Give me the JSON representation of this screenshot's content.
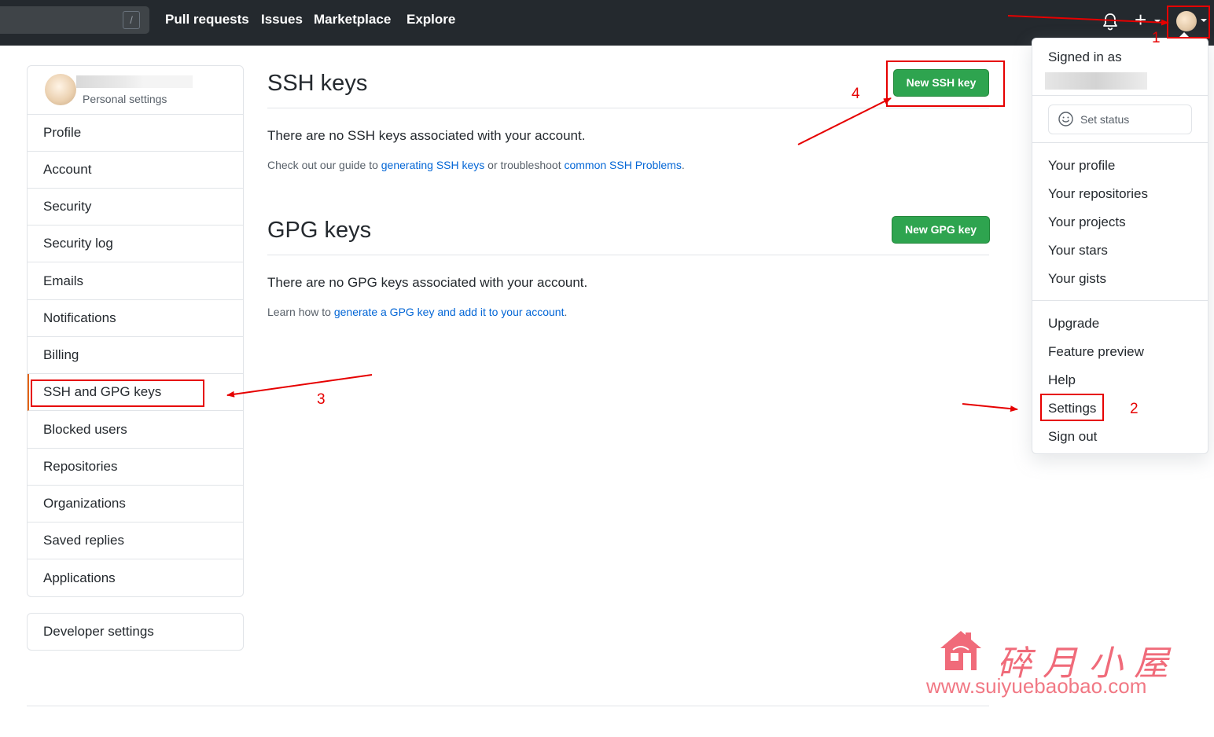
{
  "header": {
    "search_slash": "/",
    "nav": [
      "Pull requests",
      "Issues",
      "Marketplace",
      "Explore"
    ],
    "plus_icon": "+"
  },
  "sidebar": {
    "subtitle": "Personal settings",
    "items": [
      {
        "label": "Profile"
      },
      {
        "label": "Account"
      },
      {
        "label": "Security"
      },
      {
        "label": "Security log"
      },
      {
        "label": "Emails"
      },
      {
        "label": "Notifications"
      },
      {
        "label": "Billing"
      },
      {
        "label": "SSH and GPG keys"
      },
      {
        "label": "Blocked users"
      },
      {
        "label": "Repositories"
      },
      {
        "label": "Organizations"
      },
      {
        "label": "Saved replies"
      },
      {
        "label": "Applications"
      }
    ],
    "developer_settings": "Developer settings"
  },
  "ssh": {
    "title": "SSH keys",
    "button": "New SSH key",
    "empty": "There are no SSH keys associated with your account.",
    "guide_prefix": "Check out our guide to ",
    "guide_link": "generating SSH keys",
    "guide_mid": " or troubleshoot ",
    "guide_link2": "common SSH Problems",
    "guide_suffix": "."
  },
  "gpg": {
    "title": "GPG keys",
    "button": "New GPG key",
    "empty": "There are no GPG keys associated with your account.",
    "learn_prefix": "Learn how to ",
    "learn_link": "generate a GPG key and add it to your account",
    "learn_suffix": "."
  },
  "dropdown": {
    "signed_in": "Signed in as",
    "set_status": "Set status",
    "group1": [
      "Your profile",
      "Your repositories",
      "Your projects",
      "Your stars",
      "Your gists"
    ],
    "group2": [
      "Upgrade",
      "Feature preview",
      "Help",
      "Settings",
      "Sign out"
    ]
  },
  "annotations": {
    "step1": "1",
    "step2": "2",
    "step3": "3",
    "step4": "4",
    "color": "#e60000"
  },
  "watermark": {
    "chinese": "碎月小屋",
    "url": "www.suiyuebaobao.com"
  },
  "colors": {
    "header_bg": "#24292e",
    "green_button": "#2ea44f",
    "link": "#0366d6",
    "active_border": "#e36209"
  }
}
